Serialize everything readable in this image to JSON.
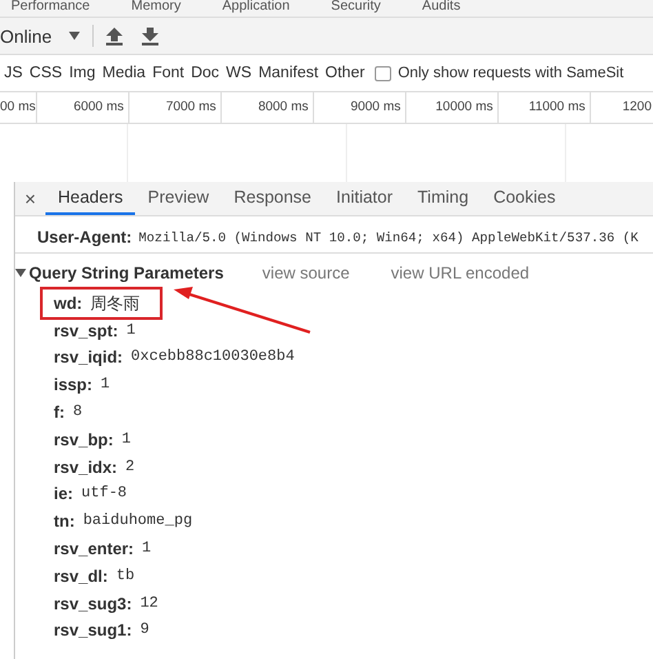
{
  "top_tabs": [
    "Performance",
    "Memory",
    "Application",
    "Security",
    "Audits"
  ],
  "toolbar": {
    "throttling": "Online"
  },
  "filters": [
    "JS",
    "CSS",
    "Img",
    "Media",
    "Font",
    "Doc",
    "WS",
    "Manifest",
    "Other"
  ],
  "same_site_filter": {
    "label": "Only show requests with SameSit",
    "checked": false
  },
  "timeline": {
    "ticks": [
      "00 ms",
      "6000 ms",
      "7000 ms",
      "8000 ms",
      "9000 ms",
      "10000 ms",
      "11000 ms",
      "1200"
    ]
  },
  "detail_tabs": {
    "close": "×",
    "tabs": [
      {
        "label": "Headers",
        "selected": true
      },
      {
        "label": "Preview",
        "selected": false
      },
      {
        "label": "Response",
        "selected": false
      },
      {
        "label": "Initiator",
        "selected": false
      },
      {
        "label": "Timing",
        "selected": false
      },
      {
        "label": "Cookies",
        "selected": false
      }
    ]
  },
  "request_headers": [
    {
      "name": "User-Agent:",
      "value": "Mozilla/5.0 (Windows NT 10.0; Win64; x64) AppleWebKit/537.36 (K"
    }
  ],
  "query_string": {
    "title": "Query String Parameters",
    "expanded": true,
    "links": [
      "view source",
      "view URL encoded"
    ],
    "params": [
      {
        "name": "wd:",
        "value": "周冬雨",
        "highlighted": true
      },
      {
        "name": "rsv_spt:",
        "value": "1",
        "highlighted": false
      },
      {
        "name": "rsv_iqid:",
        "value": "0xcebb88c10030e8b4",
        "highlighted": false
      },
      {
        "name": "issp:",
        "value": "1",
        "highlighted": false
      },
      {
        "name": "f:",
        "value": "8",
        "highlighted": false
      },
      {
        "name": "rsv_bp:",
        "value": "1",
        "highlighted": false
      },
      {
        "name": "rsv_idx:",
        "value": "2",
        "highlighted": false
      },
      {
        "name": "ie:",
        "value": "utf-8",
        "highlighted": false
      },
      {
        "name": "tn:",
        "value": "baiduhome_pg",
        "highlighted": false
      },
      {
        "name": "rsv_enter:",
        "value": "1",
        "highlighted": false
      },
      {
        "name": "rsv_dl:",
        "value": "tb",
        "highlighted": false
      },
      {
        "name": "rsv_sug3:",
        "value": "12",
        "highlighted": false
      },
      {
        "name": "rsv_sug1:",
        "value": "9",
        "highlighted": false
      }
    ]
  }
}
